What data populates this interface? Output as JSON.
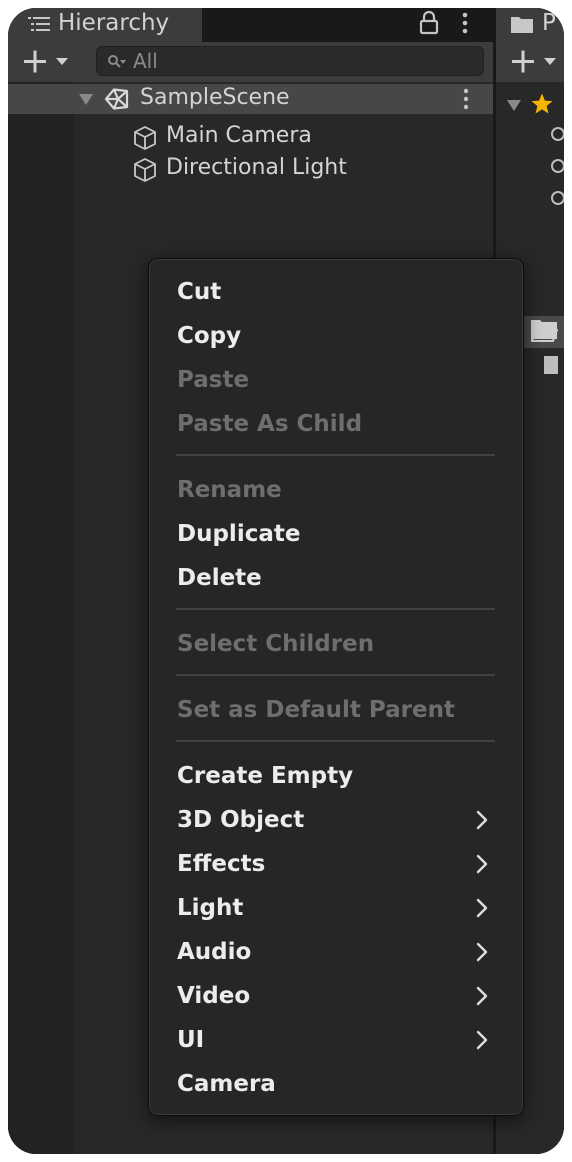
{
  "hierarchy": {
    "tab_title": "Hierarchy",
    "search_placeholder": "All",
    "scene": {
      "name": "SampleScene"
    },
    "objects": [
      {
        "name": "Main Camera"
      },
      {
        "name": "Directional Light"
      }
    ]
  },
  "project": {
    "tab_title": "P"
  },
  "context_menu": {
    "groups": [
      [
        {
          "label": "Cut",
          "enabled": true
        },
        {
          "label": "Copy",
          "enabled": true
        },
        {
          "label": "Paste",
          "enabled": false
        },
        {
          "label": "Paste As Child",
          "enabled": false
        }
      ],
      [
        {
          "label": "Rename",
          "enabled": false
        },
        {
          "label": "Duplicate",
          "enabled": true
        },
        {
          "label": "Delete",
          "enabled": true
        }
      ],
      [
        {
          "label": "Select Children",
          "enabled": false
        }
      ],
      [
        {
          "label": "Set as Default Parent",
          "enabled": false
        }
      ],
      [
        {
          "label": "Create Empty",
          "enabled": true
        },
        {
          "label": "3D Object",
          "enabled": true,
          "submenu": true
        },
        {
          "label": "Effects",
          "enabled": true,
          "submenu": true
        },
        {
          "label": "Light",
          "enabled": true,
          "submenu": true
        },
        {
          "label": "Audio",
          "enabled": true,
          "submenu": true
        },
        {
          "label": "Video",
          "enabled": true,
          "submenu": true
        },
        {
          "label": "UI",
          "enabled": true,
          "submenu": true
        },
        {
          "label": "Camera",
          "enabled": true
        }
      ]
    ]
  },
  "colors": {
    "panel_bg": "#282828",
    "selected_row": "#474747",
    "menu_bg": "#262626",
    "menu_text": "#ececec",
    "menu_text_disabled": "#6e6e6e",
    "favorites_star": "#f4b400"
  },
  "icons": {
    "hierarchy_tab": "list-icon",
    "lock": "lock-icon",
    "more": "kebab-menu-icon",
    "add": "plus-dropdown-icon",
    "search": "search-filter-icon",
    "scene": "unity-logo-icon",
    "game_object": "cube-icon",
    "submenu": "chevron-right-icon",
    "favorites": "star-icon",
    "folder": "folder-icon"
  }
}
